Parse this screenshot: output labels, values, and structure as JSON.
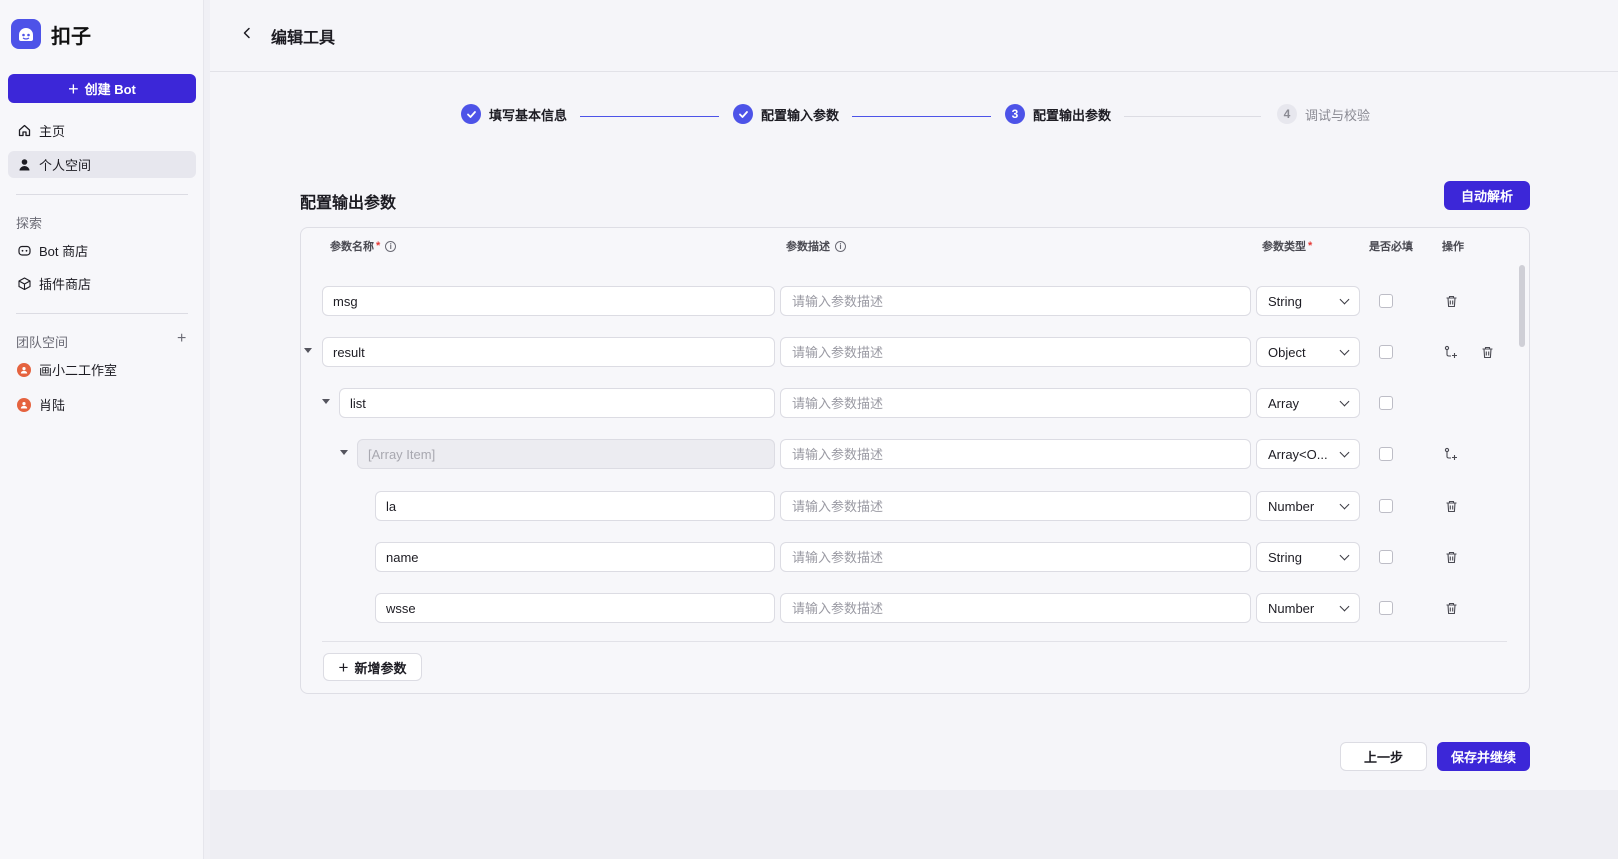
{
  "brand": {
    "name": "扣子"
  },
  "sidebar": {
    "create_label": "创建 Bot",
    "nav": [
      {
        "label": "主页",
        "icon": "home-icon"
      },
      {
        "label": "个人空间",
        "icon": "user-icon",
        "active": true
      }
    ],
    "explore_label": "探索",
    "explore": [
      {
        "label": "Bot 商店",
        "icon": "bot-icon"
      },
      {
        "label": "插件商店",
        "icon": "cube-icon"
      }
    ],
    "team_label": "团队空间",
    "teams": [
      {
        "label": "画小二工作室"
      },
      {
        "label": "肖陆"
      }
    ]
  },
  "header": {
    "title": "编辑工具"
  },
  "steps": [
    {
      "label": "填写基本信息",
      "state": "done"
    },
    {
      "label": "配置输入参数",
      "state": "done"
    },
    {
      "number": "3",
      "label": "配置输出参数",
      "state": "current"
    },
    {
      "number": "4",
      "label": "调试与校验",
      "state": "pending"
    }
  ],
  "section": {
    "title": "配置输出参数",
    "auto_parse_label": "自动解析"
  },
  "table": {
    "columns": {
      "name": "参数名称",
      "desc": "参数描述",
      "type": "参数类型",
      "required": "是否必填",
      "actions": "操作"
    },
    "desc_placeholder": "请输入参数描述",
    "rows": [
      {
        "name": "msg",
        "type": "String",
        "depth": 0,
        "expandable": false,
        "actions": [
          "delete"
        ]
      },
      {
        "name": "result",
        "type": "Object",
        "depth": 0,
        "expandable": true,
        "actions": [
          "add-child",
          "delete"
        ]
      },
      {
        "name": "list",
        "type": "Array",
        "depth": 1,
        "expandable": true,
        "actions": []
      },
      {
        "name": "[Array Item]",
        "type": "Array<O...",
        "depth": 2,
        "expandable": true,
        "disabled": true,
        "actions": [
          "add-child"
        ]
      },
      {
        "name": "la",
        "type": "Number",
        "depth": 3,
        "expandable": false,
        "actions": [
          "delete"
        ]
      },
      {
        "name": "name",
        "type": "String",
        "depth": 3,
        "expandable": false,
        "actions": [
          "delete"
        ]
      },
      {
        "name": "wsse",
        "type": "Number",
        "depth": 3,
        "expandable": false,
        "actions": [
          "delete"
        ]
      }
    ],
    "add_label": "新增参数"
  },
  "footer": {
    "prev_label": "上一步",
    "save_label": "保存并继续"
  },
  "colors": {
    "accent": "#3c27d8",
    "step": "#4d53e8",
    "team_avatar": "#e5633f"
  }
}
